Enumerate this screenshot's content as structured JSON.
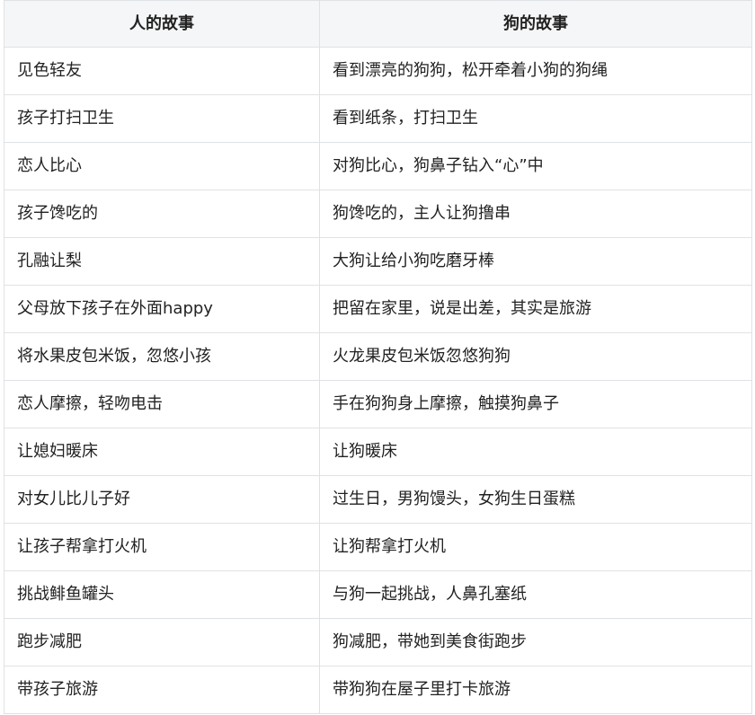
{
  "table": {
    "headers": [
      "人的故事",
      "狗的故事"
    ],
    "rows": [
      [
        "见色轻友",
        "看到漂亮的狗狗，松开牵着小狗的狗绳"
      ],
      [
        "孩子打扫卫生",
        "看到纸条，打扫卫生"
      ],
      [
        "恋人比心",
        "对狗比心，狗鼻子钻入“心”中"
      ],
      [
        "孩子馋吃的",
        "狗馋吃的，主人让狗撸串"
      ],
      [
        "孔融让梨",
        "大狗让给小狗吃磨牙棒"
      ],
      [
        "父母放下孩子在外面happy",
        "把留在家里，说是出差，其实是旅游"
      ],
      [
        "将水果皮包米饭，忽悠小孩",
        "火龙果皮包米饭忽悠狗狗"
      ],
      [
        "恋人摩擦，轻吻电击",
        "手在狗狗身上摩擦，触摸狗鼻子"
      ],
      [
        "让媳妇暖床",
        "让狗暖床"
      ],
      [
        "对女儿比儿子好",
        "过生日，男狗馒头，女狗生日蛋糕"
      ],
      [
        "让孩子帮拿打火机",
        "让狗帮拿打火机"
      ],
      [
        "挑战鲱鱼罐头",
        "与狗一起挑战，人鼻孔塞纸"
      ],
      [
        "跑步减肥",
        "狗减肥，带她到美食街跑步"
      ],
      [
        "带孩子旅游",
        "带狗狗在屋子里打卡旅游"
      ]
    ]
  }
}
